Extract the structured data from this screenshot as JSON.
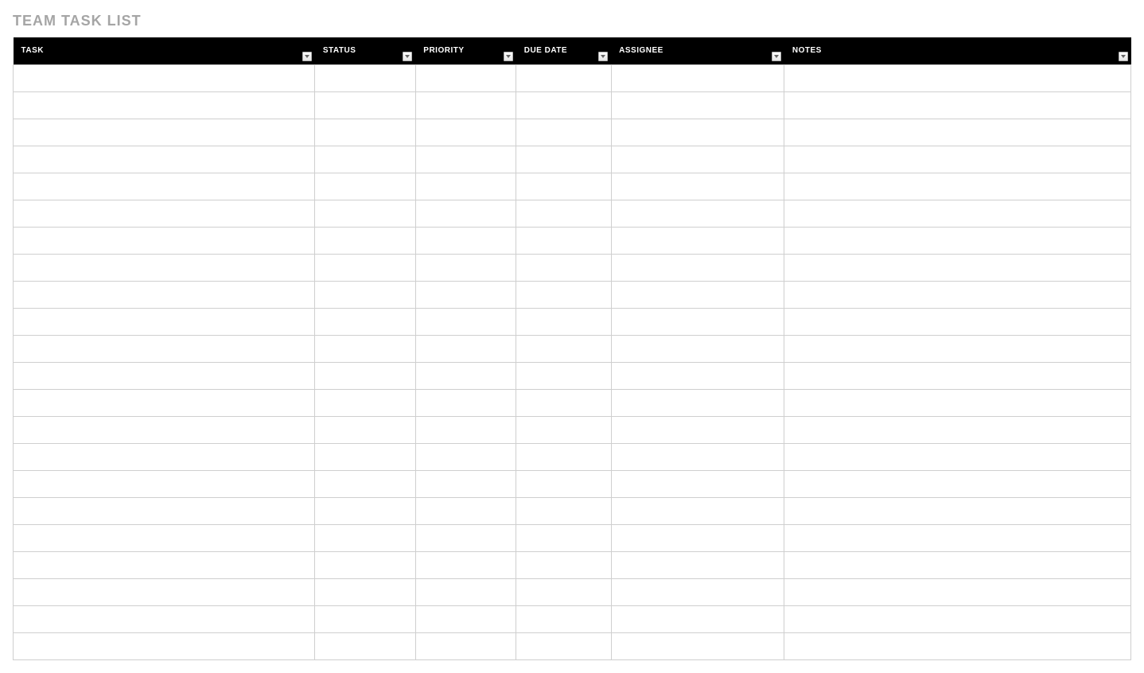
{
  "title": "TEAM TASK LIST",
  "columns": [
    {
      "label": "TASK"
    },
    {
      "label": "STATUS"
    },
    {
      "label": "PRIORITY"
    },
    {
      "label": "DUE DATE"
    },
    {
      "label": "ASSIGNEE"
    },
    {
      "label": "NOTES"
    }
  ],
  "rows": [
    {
      "task": "",
      "status": "",
      "priority": "",
      "due_date": "",
      "assignee": "",
      "notes": ""
    },
    {
      "task": "",
      "status": "",
      "priority": "",
      "due_date": "",
      "assignee": "",
      "notes": ""
    },
    {
      "task": "",
      "status": "",
      "priority": "",
      "due_date": "",
      "assignee": "",
      "notes": ""
    },
    {
      "task": "",
      "status": "",
      "priority": "",
      "due_date": "",
      "assignee": "",
      "notes": ""
    },
    {
      "task": "",
      "status": "",
      "priority": "",
      "due_date": "",
      "assignee": "",
      "notes": ""
    },
    {
      "task": "",
      "status": "",
      "priority": "",
      "due_date": "",
      "assignee": "",
      "notes": ""
    },
    {
      "task": "",
      "status": "",
      "priority": "",
      "due_date": "",
      "assignee": "",
      "notes": ""
    },
    {
      "task": "",
      "status": "",
      "priority": "",
      "due_date": "",
      "assignee": "",
      "notes": ""
    },
    {
      "task": "",
      "status": "",
      "priority": "",
      "due_date": "",
      "assignee": "",
      "notes": ""
    },
    {
      "task": "",
      "status": "",
      "priority": "",
      "due_date": "",
      "assignee": "",
      "notes": ""
    },
    {
      "task": "",
      "status": "",
      "priority": "",
      "due_date": "",
      "assignee": "",
      "notes": ""
    },
    {
      "task": "",
      "status": "",
      "priority": "",
      "due_date": "",
      "assignee": "",
      "notes": ""
    },
    {
      "task": "",
      "status": "",
      "priority": "",
      "due_date": "",
      "assignee": "",
      "notes": ""
    },
    {
      "task": "",
      "status": "",
      "priority": "",
      "due_date": "",
      "assignee": "",
      "notes": ""
    },
    {
      "task": "",
      "status": "",
      "priority": "",
      "due_date": "",
      "assignee": "",
      "notes": ""
    },
    {
      "task": "",
      "status": "",
      "priority": "",
      "due_date": "",
      "assignee": "",
      "notes": ""
    },
    {
      "task": "",
      "status": "",
      "priority": "",
      "due_date": "",
      "assignee": "",
      "notes": ""
    },
    {
      "task": "",
      "status": "",
      "priority": "",
      "due_date": "",
      "assignee": "",
      "notes": ""
    },
    {
      "task": "",
      "status": "",
      "priority": "",
      "due_date": "",
      "assignee": "",
      "notes": ""
    },
    {
      "task": "",
      "status": "",
      "priority": "",
      "due_date": "",
      "assignee": "",
      "notes": ""
    },
    {
      "task": "",
      "status": "",
      "priority": "",
      "due_date": "",
      "assignee": "",
      "notes": ""
    },
    {
      "task": "",
      "status": "",
      "priority": "",
      "due_date": "",
      "assignee": "",
      "notes": ""
    }
  ]
}
